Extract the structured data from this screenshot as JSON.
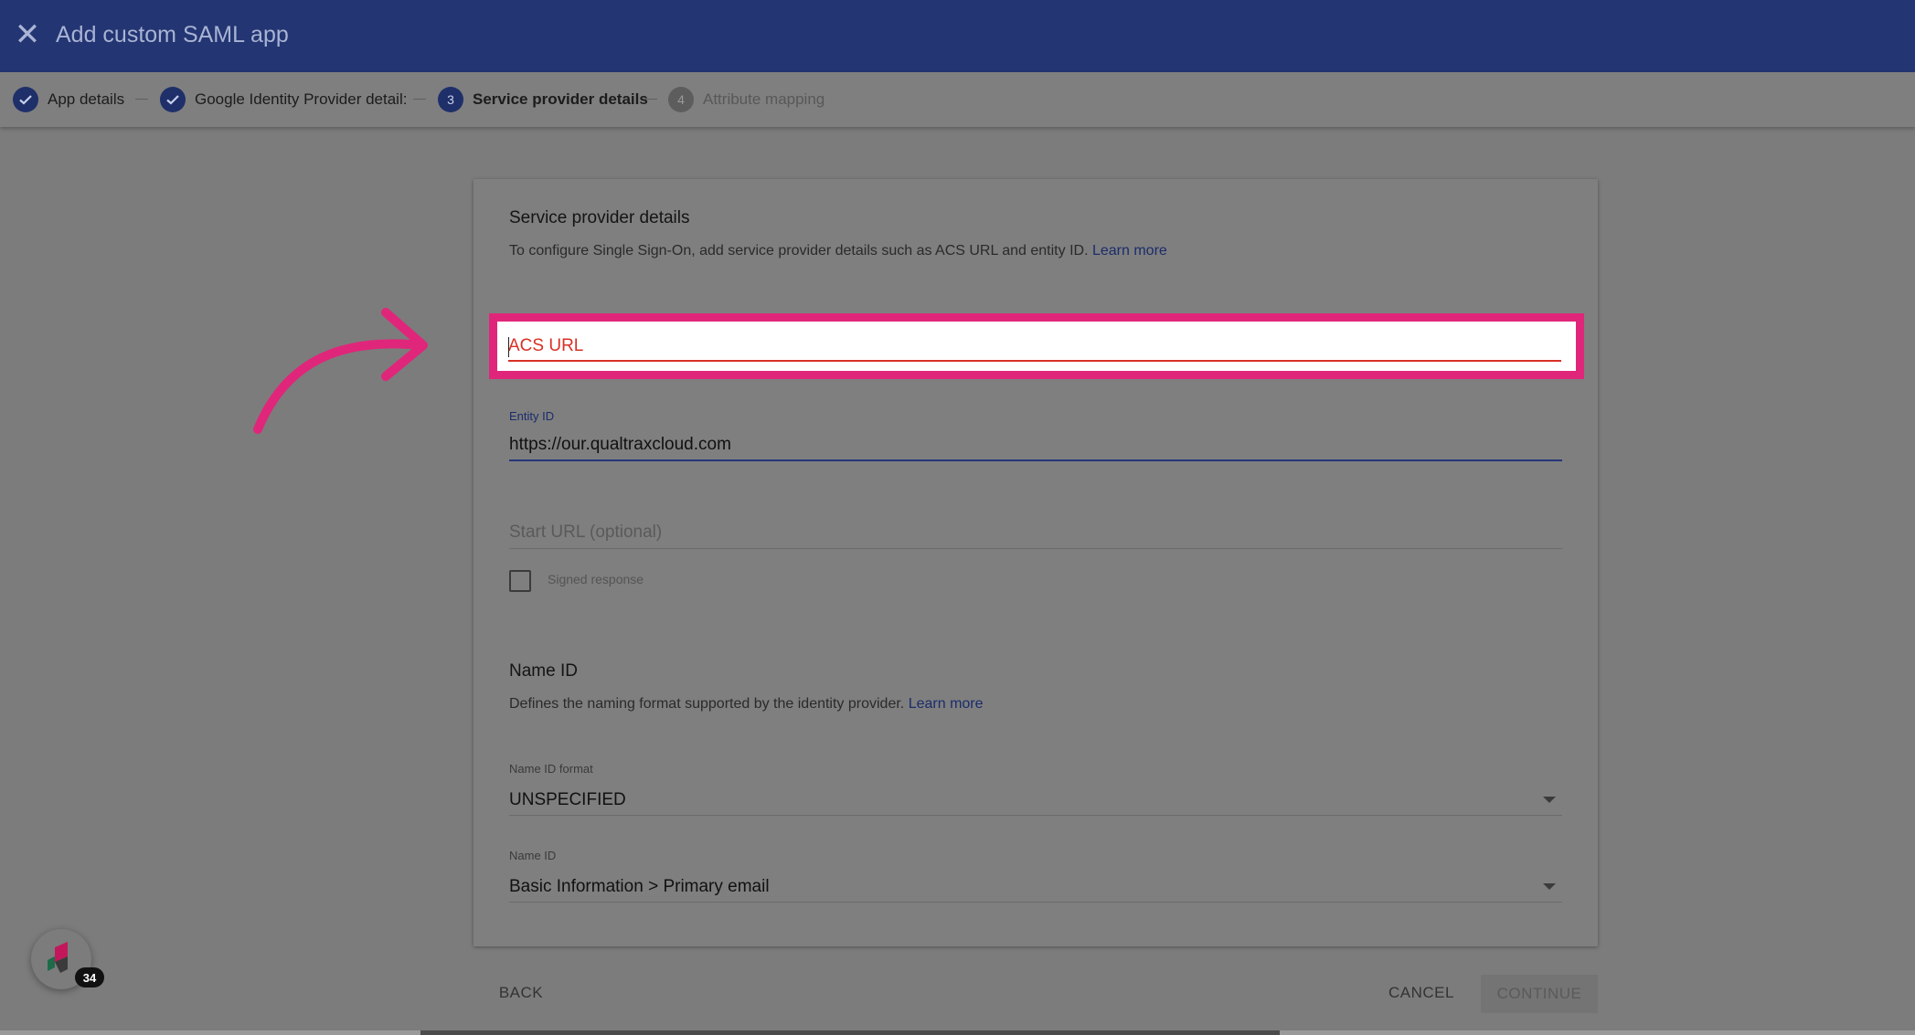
{
  "header": {
    "close_icon": "close-icon",
    "title": "Add custom SAML app"
  },
  "stepper": {
    "steps": [
      {
        "label": "App details",
        "state": "done",
        "icon": "check-icon"
      },
      {
        "label": "Google Identity Provider detail:",
        "state": "done",
        "icon": "check-icon"
      },
      {
        "label": "Service provider details",
        "state": "active",
        "number": "3"
      },
      {
        "label": "Attribute mapping",
        "state": "pending",
        "number": "4"
      }
    ]
  },
  "card": {
    "section1": {
      "title": "Service provider details",
      "description": "To configure Single Sign-On, add service provider details such as ACS URL and entity ID.",
      "learn_more": "Learn more"
    },
    "acs_url": {
      "placeholder": "ACS URL",
      "value": ""
    },
    "entity_id": {
      "label": "Entity ID",
      "value": "https://our.qualtraxcloud.com"
    },
    "start_url": {
      "placeholder": "Start URL (optional)"
    },
    "signed_response": {
      "label": "Signed response",
      "checked": false
    },
    "section2": {
      "title": "Name ID",
      "description": "Defines the naming format supported by the identity provider.",
      "learn_more": "Learn more"
    },
    "name_id_format": {
      "label": "Name ID format",
      "value": "UNSPECIFIED"
    },
    "name_id": {
      "label": "Name ID",
      "value": "Basic Information > Primary email"
    }
  },
  "footer": {
    "back": "BACK",
    "cancel": "CANCEL",
    "continue": "CONTINUE"
  },
  "helper": {
    "badge": "34"
  },
  "colors": {
    "header_bg": "#233572",
    "highlight": "#e0267a",
    "error": "#d93025",
    "accent": "#1a2c6b"
  }
}
